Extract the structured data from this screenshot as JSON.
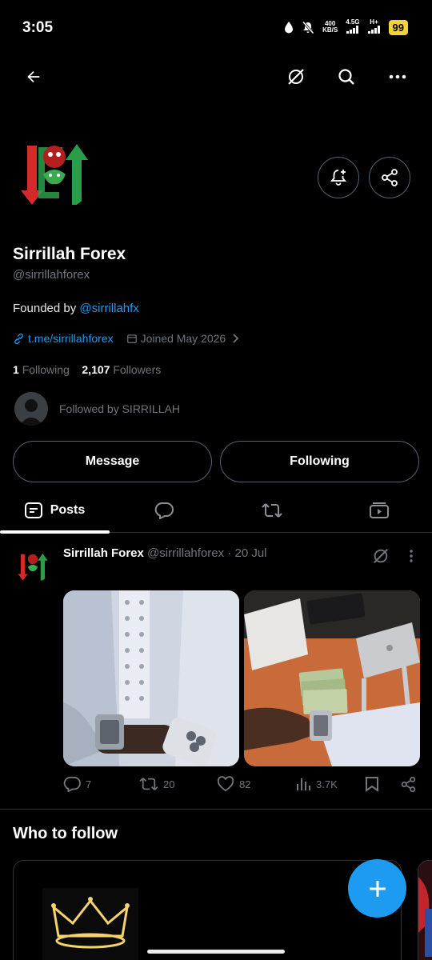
{
  "status_bar": {
    "time": "3:05",
    "speed_value": "400",
    "speed_unit": "KB/S",
    "network_1": "4.5G",
    "network_2": "H+",
    "battery": "99"
  },
  "profile": {
    "display_name": "Sirrillah Forex",
    "handle": "@sirrillahforex",
    "bio_prefix": "Founded by ",
    "bio_mention": "@sirrillahfx",
    "website": "t.me/sirrillahforex",
    "joined": "Joined May 2026",
    "following_count": "1",
    "following_label": "Following",
    "followers_count": "2,107",
    "followers_label": "Followers",
    "followed_by": "Followed by SIRRILLAH"
  },
  "buttons": {
    "message": "Message",
    "following": "Following"
  },
  "tabs": [
    {
      "label": "Posts",
      "icon": "posts-icon",
      "active": true
    },
    {
      "label": "",
      "icon": "replies-icon"
    },
    {
      "label": "",
      "icon": "reposts-icon"
    },
    {
      "label": "",
      "icon": "media-icon"
    }
  ],
  "post": {
    "author": "Sirrillah Forex",
    "handle": "@sirrillahforex",
    "separator": " · ",
    "date": "20 Jul",
    "replies": "7",
    "reposts": "20",
    "likes": "82",
    "views": "3.7K"
  },
  "who_to_follow": "Who to follow",
  "colors": {
    "accent": "#1d9bf0",
    "background": "#000000",
    "muted": "#71767b",
    "border": "#2f3336",
    "battery": "#f2d33a"
  }
}
